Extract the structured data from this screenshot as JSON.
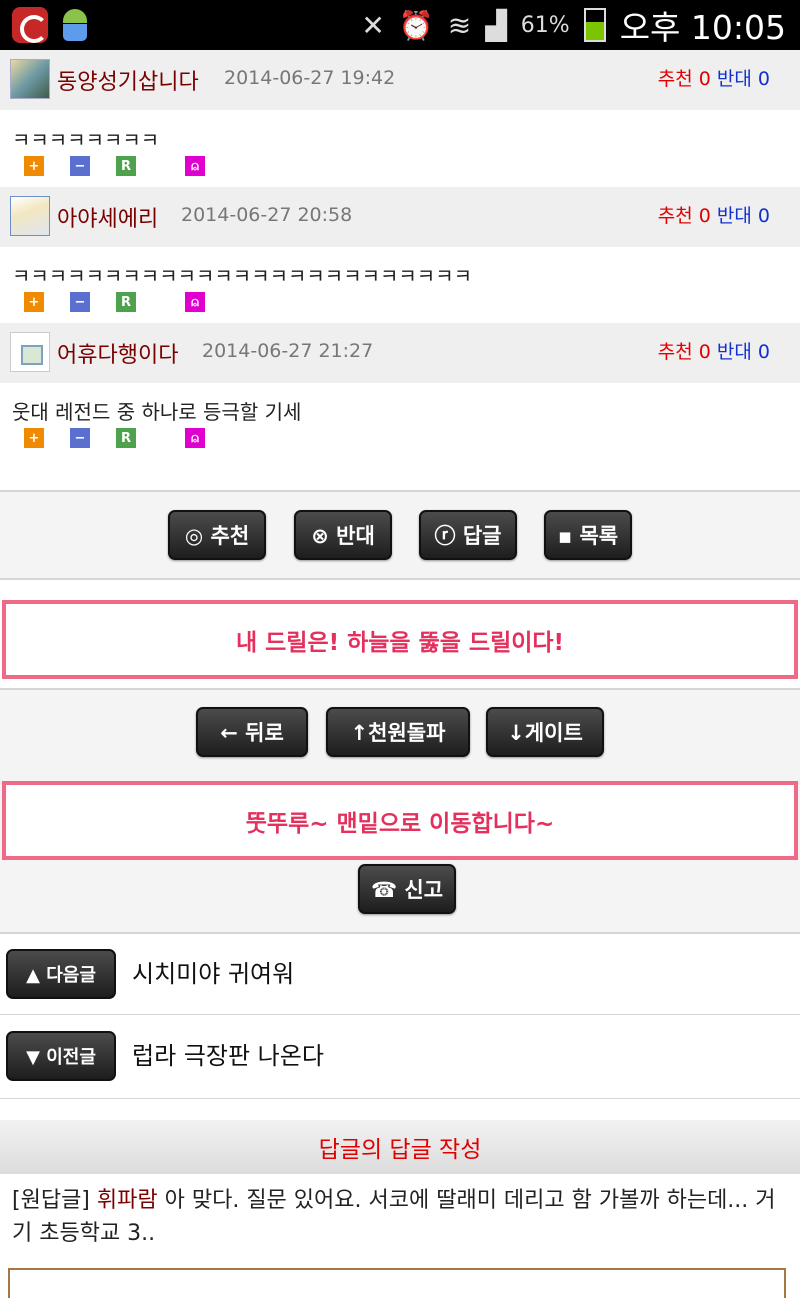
{
  "status_bar": {
    "battery": "61%",
    "time": "오후 10:05"
  },
  "comments": [
    {
      "nick": "동양성기삽니다",
      "date": "2014-06-27 19:42",
      "rec_label": "추천",
      "rec": "0",
      "opp_label": "반대",
      "opp": "0",
      "text": "ㅋㅋㅋㅋㅋㅋㅋㅋ"
    },
    {
      "nick": "아야세에리",
      "date": "2014-06-27 20:58",
      "rec_label": "추천",
      "rec": "0",
      "opp_label": "반대",
      "opp": "0",
      "text": "ㅋㅋㅋㅋㅋㅋㅋㅋㅋㅋㅋㅋㅋㅋㅋㅋㅋㅋㅋㅋㅋㅋㅋㅋㅋ"
    },
    {
      "nick": "어휴다행이다",
      "date": "2014-06-27 21:27",
      "rec_label": "추천",
      "rec": "0",
      "opp_label": "반대",
      "opp": "0",
      "text": "웃대 레전드 중 하나로 등극할 기세"
    }
  ],
  "mini_buttons": {
    "plus": "+",
    "minus": "−",
    "r": "R",
    "bell": "⍝"
  },
  "actions": {
    "recommend": "◎ 추천",
    "oppose": "⊗ 반대",
    "reply": "ⓡ 답글",
    "list": "▪ 목록"
  },
  "banner1": "내 드릴은! 하늘을 뚫을 드릴이다!",
  "nav_buttons": {
    "back": "← 뒤로",
    "top": "↑천원돌파",
    "gate": "↓게이트"
  },
  "banner2": "뚯뚜루~ 맨밑으로 이동합니다~",
  "report": "☎ 신고",
  "next": {
    "label": "▲ 다음글",
    "title": "시치미야 귀여워"
  },
  "prev": {
    "label": "▼ 이전글",
    "title": "럽라 극장판 나온다"
  },
  "reply_section": {
    "title": "답글의 답글 작성",
    "orig_prefix": "[원답글]",
    "orig_user": "휘파람",
    "orig_text": " 아 맞다. 질문 있어요. 서코에 딸래미 데리고 함 가볼까 하는데... 거기 초등학교 3.."
  }
}
